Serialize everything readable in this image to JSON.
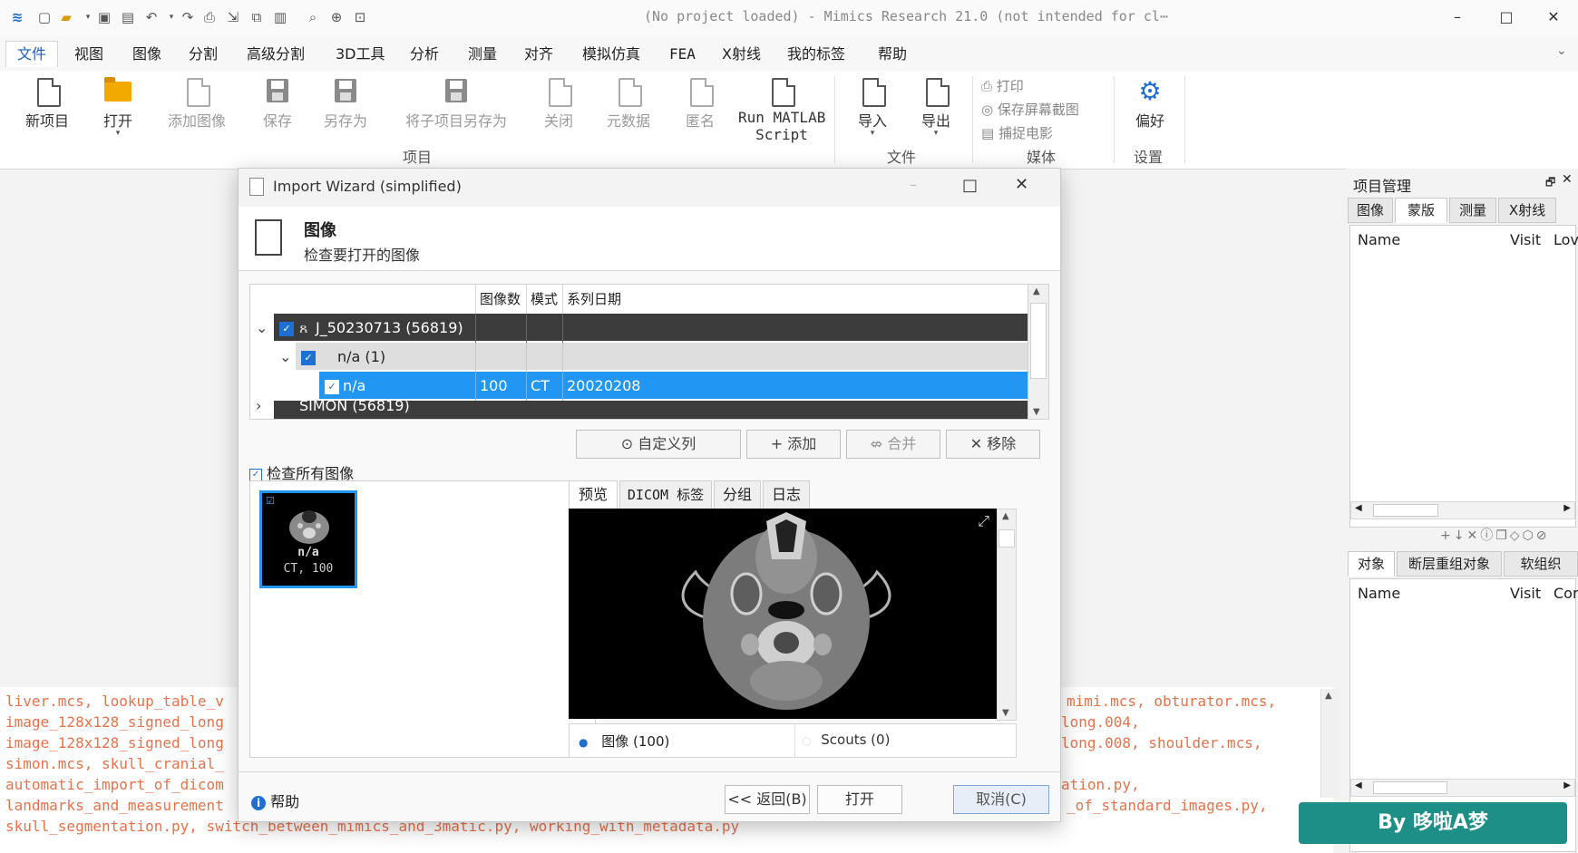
{
  "app": {
    "title": "(No project loaded) - Mimics Research 21.0 (not intended for cl⋯",
    "window_controls": [
      "–",
      "□",
      "✕"
    ]
  },
  "menu": {
    "items": [
      "文件",
      "视图",
      "图像",
      "分割",
      "高级分割",
      "3D工具",
      "分析",
      "测量",
      "对齐",
      "模拟仿真",
      "FEA",
      "X射线",
      "我的标签",
      "帮助"
    ],
    "active": "文件"
  },
  "ribbon": {
    "buttons": {
      "new_project": "新项目",
      "open": "打开",
      "add_image": "添加图像",
      "save": "保存",
      "save_as": "另存为",
      "save_subproject_as": "将子项目另存为",
      "close": "关闭",
      "metadata": "元数据",
      "anonymize": "匿名",
      "run_matlab_1": "Run MATLAB",
      "run_matlab_2": "Script",
      "import": "导入",
      "export": "导出",
      "print": "打印",
      "save_screenshot": "保存屏幕截图",
      "capture_movie": "捕捉电影",
      "preferences": "偏好"
    },
    "groups": {
      "project": "项目",
      "file": "文件",
      "media": "媒体",
      "settings": "设置"
    }
  },
  "console": {
    "left_lines": [
      "liver.mcs, lookup_table_v",
      "image_128x128_signed_long",
      "image_128x128_signed_long",
      "simon.mcs, skull_cranial_",
      "automatic_import_of_dicom",
      "landmarks_and_measurement",
      "skull_segmentation.py, switch_between_mimics_and_3matic.py, working_with_metadata.py"
    ],
    "right_lines": [
      "mimi.mcs, obturator.mcs,",
      "long.004,",
      "long.008, shoulder.mcs,",
      "",
      "ation.py,",
      "_of_standard_images.py,"
    ]
  },
  "project_manager": {
    "title": "项目管理",
    "tabs_top": [
      "图像",
      "蒙版",
      "测量",
      "X射线"
    ],
    "tabs_top_selected": "蒙版",
    "cols_top": [
      "Name",
      "Visit",
      "Lov"
    ],
    "toolbar_icons": [
      "+",
      "↓",
      "✕",
      "ⓘ",
      "❐",
      "◇",
      "⬡",
      "⊘"
    ],
    "tabs_bottom": [
      "对象",
      "断层重组对象",
      "软组织"
    ],
    "tabs_bottom_selected": "对象",
    "cols_bottom": [
      "Name",
      "Visit",
      "Cor"
    ]
  },
  "dialog": {
    "title": "Import Wizard (simplified)",
    "header_title": "图像",
    "header_subtitle": "检查要打开的图像",
    "table_headers": [
      "图像数",
      "模式",
      "系列日期"
    ],
    "rows": [
      {
        "label": "J_50230713 (56819)",
        "count": "",
        "modality": "",
        "date": ""
      },
      {
        "label": "n/a (1)",
        "count": "",
        "modality": "",
        "date": ""
      },
      {
        "label": "n/a",
        "count": "100",
        "modality": "CT",
        "date": "20020208"
      },
      {
        "label": "SIMON (56819)",
        "count": "",
        "modality": "",
        "date": ""
      }
    ],
    "table_buttons": {
      "custom_columns": "⊙ 自定义列",
      "add": "+ 添加",
      "merge": "⇎ 合并",
      "remove": "✕ 移除"
    },
    "check_all": "检查所有图像",
    "thumbnail": {
      "line1": "n/a",
      "line2": "CT, 100"
    },
    "preview_tabs": [
      "预览",
      "DICOM 标签",
      "分组",
      "日志"
    ],
    "preview_tab_selected": "预览",
    "radio_images": "图像  (100)",
    "radio_scouts": "Scouts  (0)",
    "help": "帮助",
    "back": "<< 返回(B)",
    "open": "打开",
    "cancel": "取消(C)"
  },
  "watermark": "By 哆啦A梦",
  "colors": {
    "accent": "#1d6fd1",
    "selected_row": "#2196f3",
    "dark_row": "#3c3c3c",
    "console_text": "#e8724a",
    "watermark_bg": "#1d8f86"
  }
}
